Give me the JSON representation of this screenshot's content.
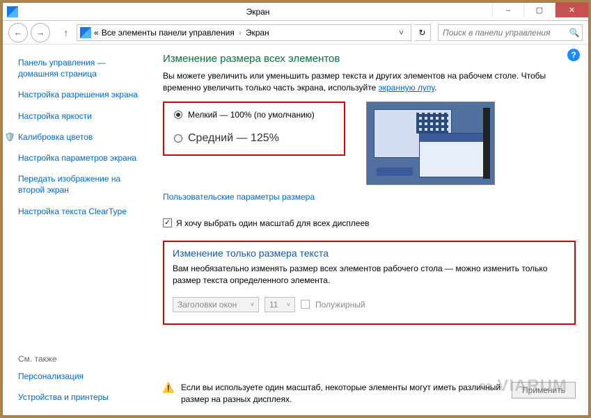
{
  "window": {
    "title": "Экран",
    "minimize": "–",
    "maximize": "▢",
    "close": "✕"
  },
  "nav": {
    "back": "←",
    "forward": "→",
    "up": "↑",
    "bc_prefix": "«",
    "bc_parent": "Все элементы панели управления",
    "bc_sep": "›",
    "bc_current": "Экран",
    "bc_drop": "˅",
    "refresh": "↻",
    "search_placeholder": "Поиск в панели управления",
    "search_icon": "🔍"
  },
  "sidebar": {
    "items": [
      "Панель управления — домашняя страница",
      "Настройка разрешения экрана",
      "Настройка яркости",
      "Калибровка цветов",
      "Настройка параметров экрана",
      "Передать изображение на второй экран",
      "Настройка текста ClearType"
    ],
    "see_also_header": "См. также",
    "see_also": [
      "Персонализация",
      "Устройства и принтеры"
    ]
  },
  "main": {
    "help": "?",
    "heading1": "Изменение размера всех элементов",
    "desc1_a": "Вы можете увеличить или уменьшить размер текста и других элементов на рабочем столе. Чтобы временно увеличить только часть экрана, используйте ",
    "desc1_link": "экранную лупу",
    "desc1_b": ".",
    "radio_small": "Мелкий — 100% (по умолчанию)",
    "radio_medium": "Средний — 125%",
    "custom_link": "Пользовательские параметры размера",
    "cb_check": "✓",
    "cb_scale": "Я хочу выбрать один масштаб для всех дисплеев",
    "heading2": "Изменение только размера текста",
    "desc2": "Вам необязательно изменять размер всех элементов рабочего стола — можно изменить только размер текста определенного элемента.",
    "combo_item": "Заголовки окон",
    "combo_size": "11",
    "combo_carr": "˅",
    "cb_bold": "Полужирный",
    "warn_icon": "⚠️",
    "warn_text": "Если вы используете один масштаб, некоторые элементы могут иметь различный размер на разных дисплеях.",
    "apply": "Применить"
  },
  "watermark": {
    "symbol": "∞",
    "text": "VIARUM"
  }
}
